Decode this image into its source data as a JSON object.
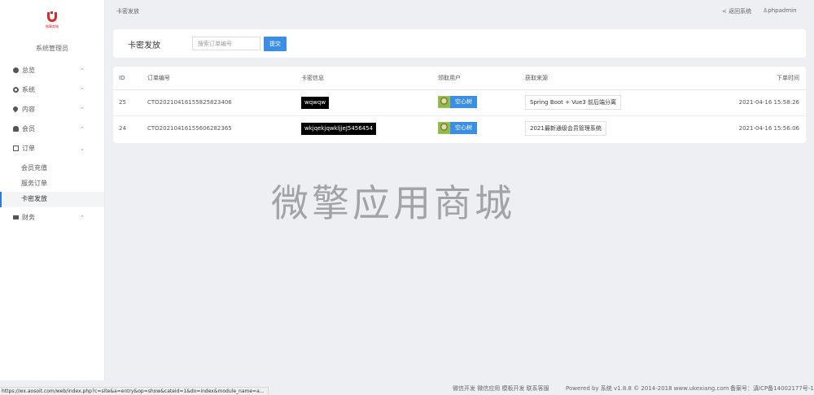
{
  "sidebar": {
    "logo_text": "微擎商城",
    "admin_label": "系统管理员",
    "nav": [
      {
        "label": "总览",
        "icon": "pie-chart-icon",
        "caret": "⌃"
      },
      {
        "label": "系统",
        "icon": "gear-icon",
        "caret": "⌃"
      },
      {
        "label": "内容",
        "icon": "map-pin-icon",
        "caret": "⌃"
      },
      {
        "label": "会员",
        "icon": "user-icon",
        "caret": "⌃"
      },
      {
        "label": "订单",
        "icon": "document-icon",
        "caret": "⌄"
      }
    ],
    "order_sub": [
      "会员充值",
      "服务订单",
      "卡密发放"
    ],
    "finance": {
      "label": "财务",
      "icon": "card-icon",
      "caret": "⌃"
    }
  },
  "topbar": {
    "breadcrumb": "卡密发放",
    "back_link": "< 返回系统",
    "user": "phpadmin"
  },
  "search": {
    "title": "卡密发放",
    "placeholder": "搜索订单编号",
    "submit": "提交"
  },
  "table": {
    "headers": [
      "ID",
      "订单编号",
      "卡密信息",
      "领取用户",
      "获取来源",
      "下单时间"
    ],
    "rows": [
      {
        "id": "25",
        "order_no": "CTO20210416155825823406",
        "card": "wqwqw",
        "user": "空心树",
        "source": "Spring Boot + Vue3 前后端分离",
        "time": "2021-04-16 15:58:26"
      },
      {
        "id": "24",
        "order_no": "CTO20210416155606282365",
        "card": "wkjqekjqwkljjeJ5456454",
        "user": "空心树",
        "source": "2021最新通级会员管理系统",
        "time": "2021-04-16 15:56:06"
      }
    ]
  },
  "watermark": "微擎应用商城",
  "footer": {
    "status_url": "https://wx.aosoit.com/web/index.php?c=site&a=entry&op=show&cateid=1&do=index&module_name=a...",
    "links": "微信开发 微信应用 模板开发 联系客服",
    "powered": "Powered by 系统 v1.8.8 © 2014-2018 www.ukexiang.com",
    "icp": "备案号：滇ICP备14002177号-1"
  },
  "colors": {
    "accent": "#3a8ee6",
    "logo": "#d92b2b",
    "active_bar": "#2b79e1"
  }
}
